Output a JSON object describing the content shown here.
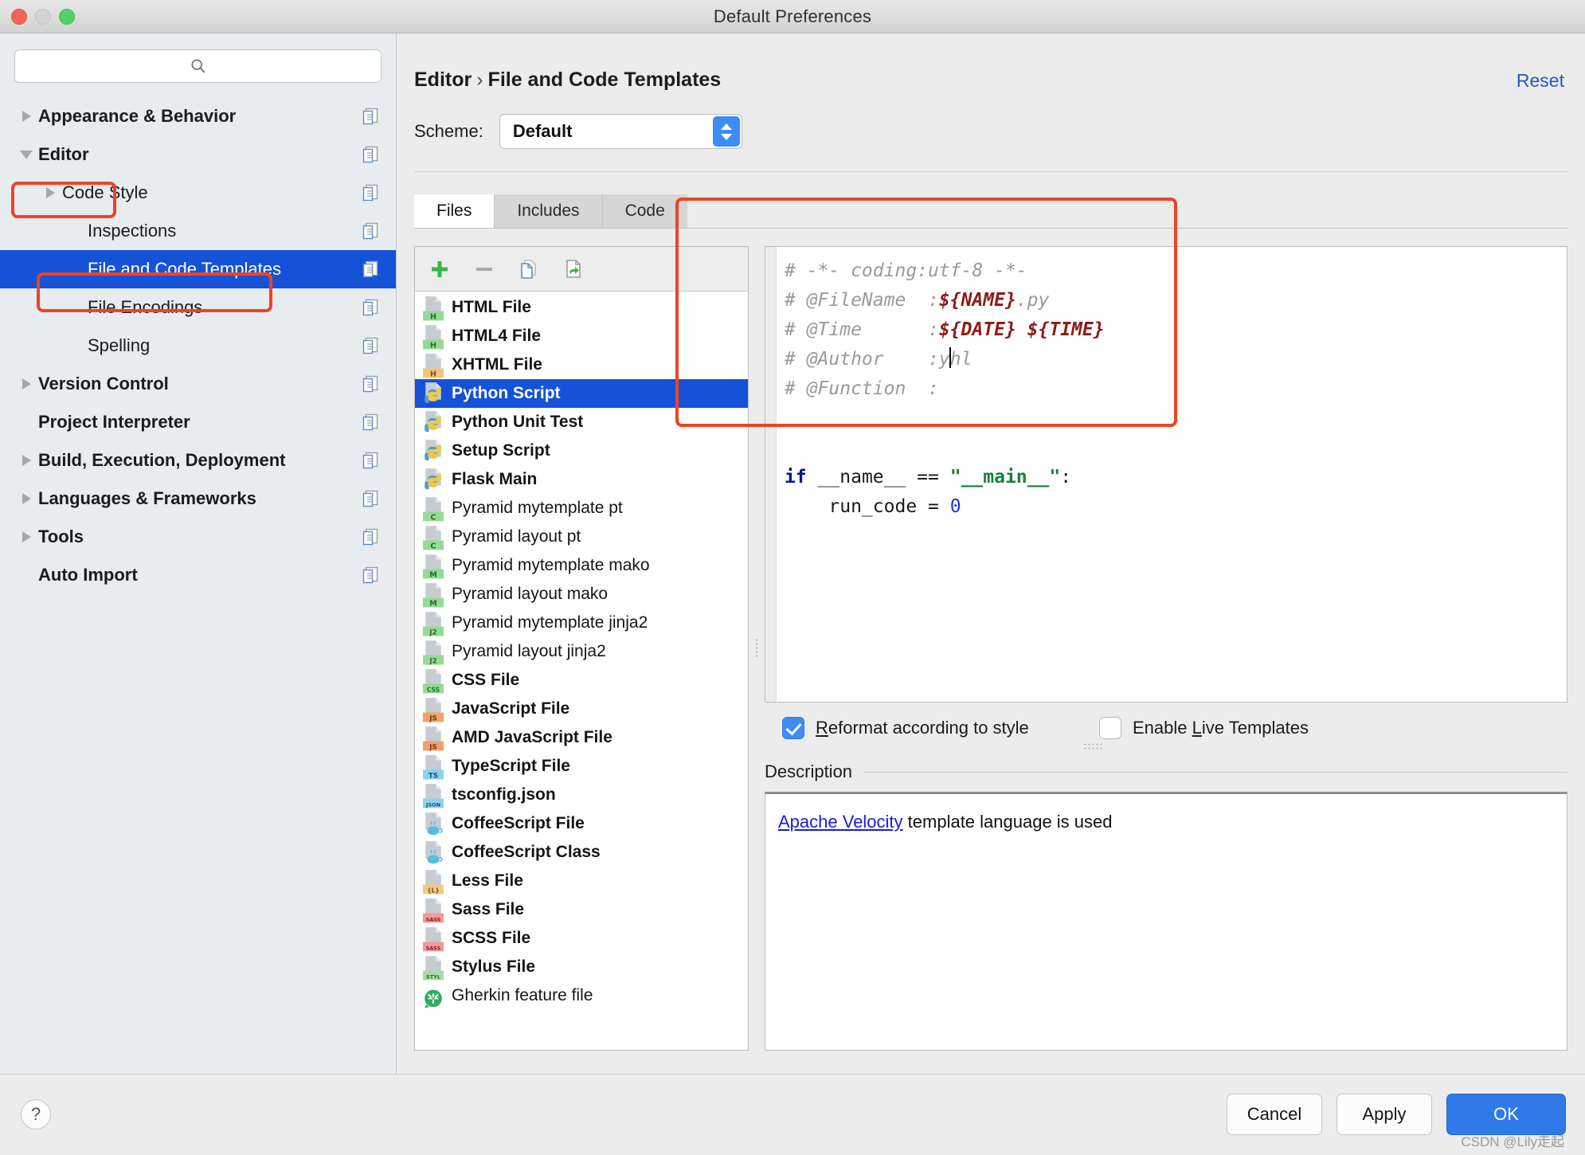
{
  "window": {
    "title": "Default Preferences",
    "traffic_lights": [
      "close",
      "minimize",
      "zoom"
    ]
  },
  "sidebar": {
    "search_placeholder": "",
    "items": [
      {
        "label": "Appearance & Behavior",
        "level": 0,
        "arrow": "right",
        "bold": true,
        "selected": false
      },
      {
        "label": "Editor",
        "level": 0,
        "arrow": "down",
        "bold": true,
        "selected": false,
        "highlight_box": true
      },
      {
        "label": "Code Style",
        "level": 1,
        "arrow": "right",
        "bold": false,
        "selected": false
      },
      {
        "label": "Inspections",
        "level": 2,
        "arrow": "none",
        "bold": false,
        "selected": false
      },
      {
        "label": "File and Code Templates",
        "level": 2,
        "arrow": "none",
        "bold": false,
        "selected": true,
        "highlight_box": true
      },
      {
        "label": "File Encodings",
        "level": 2,
        "arrow": "none",
        "bold": false,
        "selected": false
      },
      {
        "label": "Spelling",
        "level": 2,
        "arrow": "none",
        "bold": false,
        "selected": false
      },
      {
        "label": "Version Control",
        "level": 0,
        "arrow": "right",
        "bold": true,
        "selected": false
      },
      {
        "label": "Project Interpreter",
        "level": 0,
        "arrow": "none",
        "bold": true,
        "selected": false
      },
      {
        "label": "Build, Execution, Deployment",
        "level": 0,
        "arrow": "right",
        "bold": true,
        "selected": false
      },
      {
        "label": "Languages & Frameworks",
        "level": 0,
        "arrow": "right",
        "bold": true,
        "selected": false
      },
      {
        "label": "Tools",
        "level": 0,
        "arrow": "right",
        "bold": true,
        "selected": false
      },
      {
        "label": "Auto Import",
        "level": 0,
        "arrow": "none",
        "bold": true,
        "selected": false
      }
    ]
  },
  "header": {
    "breadcrumb_root": "Editor",
    "breadcrumb_separator": "›",
    "breadcrumb_leaf": "File and Code Templates",
    "reset_label": "Reset",
    "scheme_label": "Scheme:",
    "scheme_value": "Default"
  },
  "tabs": [
    {
      "label": "Files",
      "active": true
    },
    {
      "label": "Includes",
      "active": false
    },
    {
      "label": "Code",
      "active": false
    }
  ],
  "list_toolbar": [
    {
      "name": "add",
      "label": "+"
    },
    {
      "name": "remove",
      "label": "−"
    },
    {
      "name": "copy",
      "label": ""
    },
    {
      "name": "reset",
      "label": ""
    }
  ],
  "templates": [
    {
      "name": "HTML File",
      "icon": "html-green",
      "bold": true,
      "selected": false
    },
    {
      "name": "HTML4 File",
      "icon": "html-green",
      "bold": true,
      "selected": false
    },
    {
      "name": "XHTML File",
      "icon": "html-orange",
      "bold": true,
      "selected": false
    },
    {
      "name": "Python Script",
      "icon": "python",
      "bold": true,
      "selected": true
    },
    {
      "name": "Python Unit Test",
      "icon": "python",
      "bold": true,
      "selected": false
    },
    {
      "name": "Setup Script",
      "icon": "python",
      "bold": true,
      "selected": false
    },
    {
      "name": "Flask Main",
      "icon": "python",
      "bold": true,
      "selected": false
    },
    {
      "name": "Pyramid mytemplate pt",
      "icon": "c-green",
      "bold": false,
      "selected": false
    },
    {
      "name": "Pyramid layout pt",
      "icon": "c-green",
      "bold": false,
      "selected": false
    },
    {
      "name": "Pyramid mytemplate mako",
      "icon": "m-green",
      "bold": false,
      "selected": false
    },
    {
      "name": "Pyramid layout mako",
      "icon": "m-green",
      "bold": false,
      "selected": false
    },
    {
      "name": "Pyramid mytemplate jinja2",
      "icon": "j2-green",
      "bold": false,
      "selected": false
    },
    {
      "name": "Pyramid layout jinja2",
      "icon": "j2-green",
      "bold": false,
      "selected": false
    },
    {
      "name": "CSS File",
      "icon": "css-green",
      "bold": true,
      "selected": false
    },
    {
      "name": "JavaScript File",
      "icon": "js-orange",
      "bold": true,
      "selected": false
    },
    {
      "name": "AMD JavaScript File",
      "icon": "js-orange",
      "bold": true,
      "selected": false
    },
    {
      "name": "TypeScript File",
      "icon": "ts-blue",
      "bold": true,
      "selected": false
    },
    {
      "name": "tsconfig.json",
      "icon": "json-blue",
      "bold": true,
      "selected": false
    },
    {
      "name": "CoffeeScript File",
      "icon": "coffee",
      "bold": true,
      "selected": false
    },
    {
      "name": "CoffeeScript Class",
      "icon": "coffee",
      "bold": true,
      "selected": false
    },
    {
      "name": "Less File",
      "icon": "less-orange",
      "bold": true,
      "selected": false
    },
    {
      "name": "Sass File",
      "icon": "sass-pink",
      "bold": true,
      "selected": false
    },
    {
      "name": "SCSS File",
      "icon": "sass-pink",
      "bold": true,
      "selected": false
    },
    {
      "name": "Stylus File",
      "icon": "styl-green",
      "bold": true,
      "selected": false
    },
    {
      "name": "Gherkin feature file",
      "icon": "cucumber",
      "bold": false,
      "selected": false
    }
  ],
  "editor": {
    "lines": [
      [
        {
          "t": "# -*- coding:utf-8 -*-",
          "s": "cm"
        }
      ],
      [
        {
          "t": "# @FileName  :",
          "s": "cm"
        },
        {
          "t": "${NAME}",
          "s": "var"
        },
        {
          "t": ".py",
          "s": "cm"
        }
      ],
      [
        {
          "t": "# @Time      :",
          "s": "cm"
        },
        {
          "t": "${DATE} ${TIME}",
          "s": "var"
        }
      ],
      [
        {
          "t": "# @Author    :y",
          "s": "cm"
        },
        {
          "t": "|caret|",
          "s": "caret"
        },
        {
          "t": "hl",
          "s": "cm"
        }
      ],
      [
        {
          "t": "# @Function  :",
          "s": "cm"
        }
      ],
      [],
      [],
      [
        {
          "t": "if",
          "s": "kw"
        },
        {
          "t": " __name__ == ",
          "s": "plain"
        },
        {
          "t": "\"__main__\"",
          "s": "str"
        },
        {
          "t": ":",
          "s": "plain"
        }
      ],
      [
        {
          "t": "    run_code = ",
          "s": "plain"
        },
        {
          "t": "0",
          "s": "num"
        }
      ]
    ]
  },
  "options": {
    "reformat": {
      "label": "Reformat according to style",
      "checked": true,
      "mnemonic": "R"
    },
    "live_templates": {
      "label": "Enable Live Templates",
      "checked": false,
      "mnemonic": "L"
    }
  },
  "description": {
    "title": "Description",
    "link_text": "Apache Velocity",
    "rest_text": " template language is used"
  },
  "footer": {
    "help_label": "?",
    "cancel_label": "Cancel",
    "apply_label": "Apply",
    "ok_label": "OK",
    "watermark": "CSDN @Lily走起"
  },
  "colors": {
    "selection_blue": "#1552d8",
    "accent_blue": "#2f7ae8",
    "annotation_red": "#ee4422",
    "link_blue": "#1a1ae0"
  }
}
